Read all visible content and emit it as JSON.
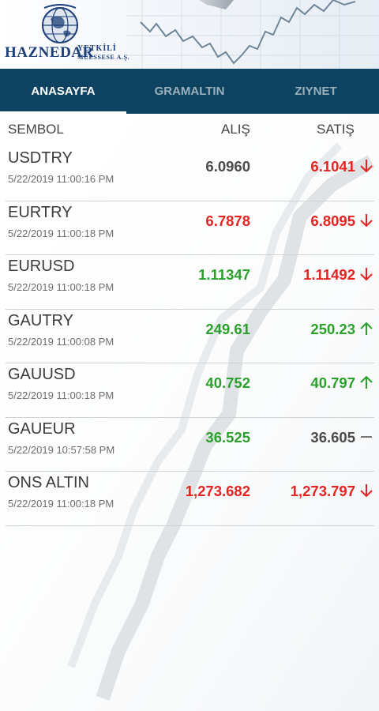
{
  "header": {
    "brand": "HAZNEDAR",
    "sub_line1": "YETKİLİ",
    "sub_line2": "MÜESSESE A.Ş."
  },
  "tabs": [
    {
      "label": "ANASAYFA",
      "active": true
    },
    {
      "label": "GRAMALTIN",
      "active": false
    },
    {
      "label": "ZIYNET",
      "active": false
    }
  ],
  "table": {
    "headers": {
      "symbol": "SEMBOL",
      "buy": "ALIŞ",
      "sell": "SATIŞ"
    },
    "rows": [
      {
        "symbol": "USDTRY",
        "time": "5/22/2019 11:00:16 PM",
        "buy": "6.0960",
        "sell": "6.1041",
        "buy_trend": "flat",
        "sell_trend": "down"
      },
      {
        "symbol": "EURTRY",
        "time": "5/22/2019 11:00:18 PM",
        "buy": "6.7878",
        "sell": "6.8095",
        "buy_trend": "down",
        "sell_trend": "down"
      },
      {
        "symbol": "EURUSD",
        "time": "5/22/2019 11:00:18 PM",
        "buy": "1.11347",
        "sell": "1.11492",
        "buy_trend": "up",
        "sell_trend": "down"
      },
      {
        "symbol": "GAUTRY",
        "time": "5/22/2019 11:00:08 PM",
        "buy": "249.61",
        "sell": "250.23",
        "buy_trend": "up",
        "sell_trend": "up"
      },
      {
        "symbol": "GAUUSD",
        "time": "5/22/2019 11:00:18 PM",
        "buy": "40.752",
        "sell": "40.797",
        "buy_trend": "up",
        "sell_trend": "up"
      },
      {
        "symbol": "GAUEUR",
        "time": "5/22/2019 10:57:58 PM",
        "buy": "36.525",
        "sell": "36.605",
        "buy_trend": "up",
        "sell_trend": "flat"
      },
      {
        "symbol": "ONS ALTIN",
        "time": "5/22/2019 11:00:18 PM",
        "buy": "1,273.682",
        "sell": "1,273.797",
        "buy_trend": "down",
        "sell_trend": "down"
      }
    ]
  },
  "colors": {
    "up": "#2ca02c",
    "down": "#e52421",
    "flat": "#4a4a4a",
    "tab_bar": "#0d4360",
    "brand": "#1d3f7a"
  },
  "icons": {
    "up": "arrow-up-icon",
    "down": "arrow-down-icon",
    "flat": "dash-icon"
  }
}
